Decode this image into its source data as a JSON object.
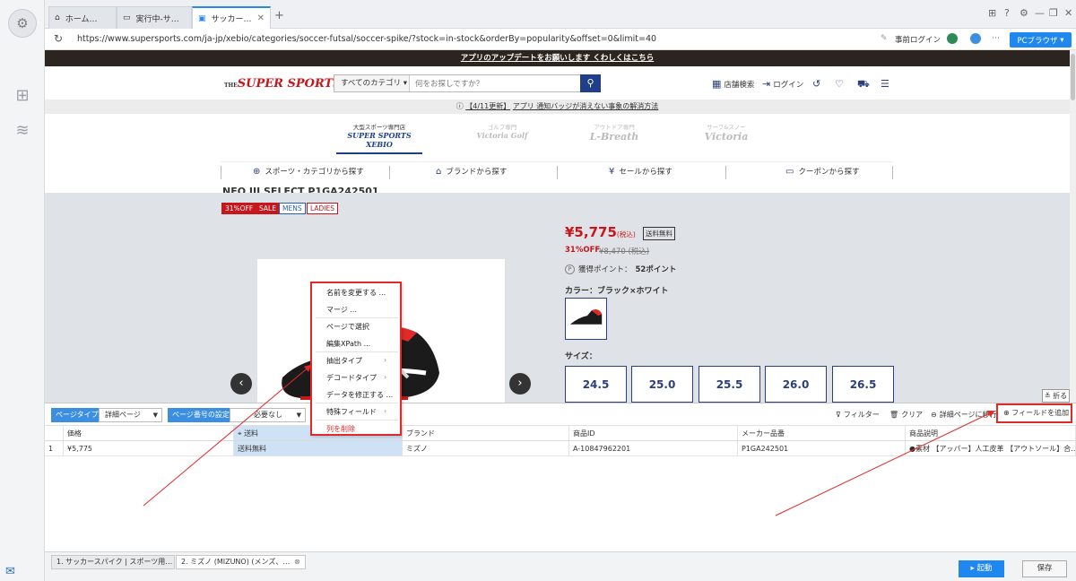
{
  "tabs": [
    {
      "label": "ホーム…",
      "icon": "home-icon"
    },
    {
      "label": "実行中-サ…",
      "icon": "document-icon"
    },
    {
      "label": "サッカー…",
      "icon": "browser-icon",
      "active": true
    }
  ],
  "address": {
    "url": "https://www.supersports.com/ja-jp/xebio/categories/soccer-futsal/soccer-spike/?stock=in-stock&orderBy=popularity&offset=0&limit=40",
    "prelogin": "事前ログイン",
    "browser_mode": "PCブラウザ"
  },
  "site": {
    "banner": "アプリのアップデートをお願いします くわしくはこちら",
    "logo": "SUPER SPORTS",
    "logo_prefix": "THE",
    "search_category": "すべてのカテゴリ",
    "search_placeholder": "何をお探しですか？",
    "nav": {
      "stores": "店舗検索",
      "login": "ログイン"
    },
    "notice_tag": "【4/11更新】",
    "notice_text": "アプリ 通知バッジが消えない事象の解消方法",
    "stores": [
      {
        "tag": "大型スポーツ専門店",
        "name": "SUPER SPORTS XEBIO"
      },
      {
        "tag": "ゴルフ専門",
        "name": "Victoria Golf"
      },
      {
        "tag": "アウトドア専門",
        "name": "L-Breath"
      },
      {
        "tag": "サーフ&スノー",
        "name": "Victoria"
      }
    ],
    "category_nav": [
      "スポーツ・カテゴリから探す",
      "ブランドから探す",
      "セールから探す",
      "クーポンから探す"
    ]
  },
  "product": {
    "title_partial": "NEO III SELECT P1GA242501",
    "badges": [
      "31%OFF",
      "SALE",
      "MENS",
      "LADIES"
    ],
    "price": "¥5,775",
    "tax": "(税込)",
    "free_shipping": "送料無料",
    "discount": "31%OFF",
    "old_price": "¥8,470",
    "old_tax": "(税込)",
    "points_label": "獲得ポイント：",
    "points_value": "52ポイント",
    "color_label": "カラー：ブラック×ホワイト",
    "size_label": "サイズ：",
    "sizes": [
      "24.5",
      "25.0",
      "25.5",
      "26.0",
      "26.5"
    ]
  },
  "context_menu": {
    "items": [
      "名前を変更する ...",
      "マージ ...",
      "ページで選択",
      "編集XPath ...",
      "抽出タイプ",
      "デコードタイプ",
      "データを修正する ...",
      "特殊フィールド",
      "列を削除"
    ]
  },
  "panel": {
    "fold": "折る",
    "page_type_label": "ページタイプ",
    "page_type_value": "詳細ページ",
    "page_number_label": "ページ番号の設定",
    "page_number_value": "必要なし",
    "filter": "フィルター",
    "clear": "クリア",
    "goto_detail": "詳細ページに移行",
    "add_field": "フィールドを追加"
  },
  "table": {
    "columns": [
      "価格",
      "送料",
      "ブランド",
      "商品ID",
      "メーカー品番",
      "商品説明"
    ],
    "rows": [
      {
        "index": "1",
        "cells": [
          "¥5,775",
          "送料無料",
          "ミズノ",
          "A-10847962201",
          "P1GA242501",
          "●素材 【アッパー】人工皮革 【アウトソール】合…"
        ]
      }
    ]
  },
  "bottom_tabs": [
    "1. サッカースパイク | スポーツ用…",
    "2. ミズノ (MIZUNO) (メンズ、…"
  ],
  "actions": {
    "run": "起動",
    "save": "保存"
  },
  "colors": {
    "accent": "#1e88f0",
    "brand_red": "#c8161d",
    "highlight": "#e02a2a",
    "navy": "#1f3f8a"
  }
}
